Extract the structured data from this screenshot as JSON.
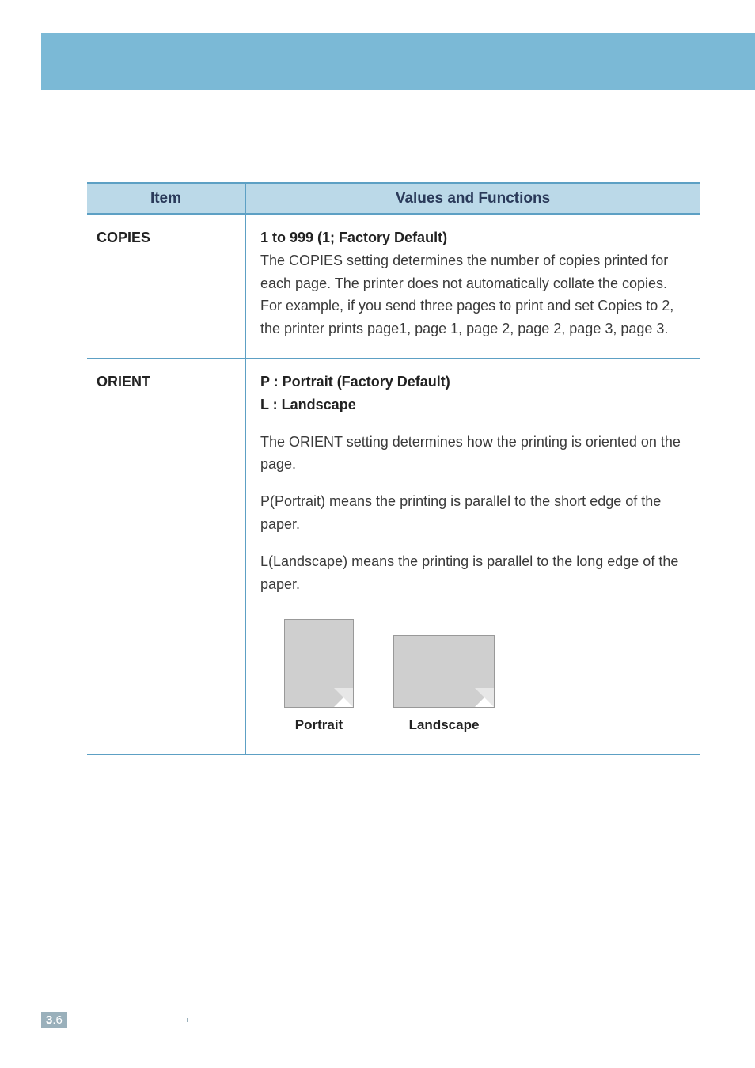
{
  "header": {
    "title": ""
  },
  "table": {
    "head": {
      "item": "Item",
      "values": "Values and Functions"
    },
    "rows": [
      {
        "item": "COPIES",
        "bold1": "1 to 999 (1; Factory Default)",
        "body": "The COPIES setting determines the number of copies printed for each page. The printer does not automatically collate the copies. For example, if you send three pages to print and set Copies to 2, the printer prints page1, page 1, page 2, page 2, page 3, page 3."
      },
      {
        "item": "ORIENT",
        "bold1": "P : Portrait (Factory Default)",
        "bold2": "L : Landscape",
        "p1": "The ORIENT setting determines how the printing is oriented on the page.",
        "p2": "P(Portrait) means the printing is parallel to the short edge of  the paper.",
        "p3": "L(Landscape) means the printing is parallel to the long edge of the paper.",
        "cap1": "Portrait",
        "cap2": "Landscape"
      }
    ]
  },
  "footer": {
    "chapter": "3",
    "page": ".6"
  }
}
